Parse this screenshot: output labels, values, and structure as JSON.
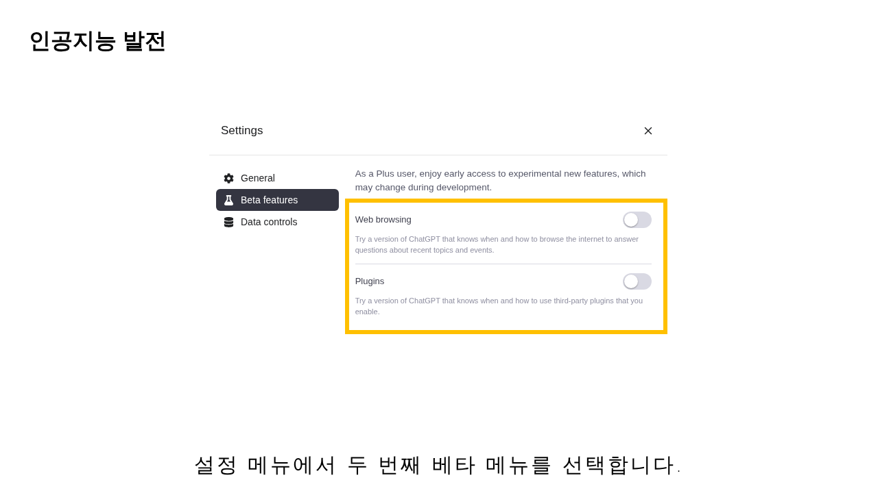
{
  "slide": {
    "title": "인공지능 발전",
    "caption": "설정 메뉴에서 두 번째 베타 메뉴를 선택합니다."
  },
  "dialog": {
    "title": "Settings",
    "sidebar": {
      "items": [
        {
          "label": "General",
          "selected": false
        },
        {
          "label": "Beta features",
          "selected": true
        },
        {
          "label": "Data controls",
          "selected": false
        }
      ]
    },
    "intro": "As a Plus user, enjoy early access to experimental new features, which may change during development.",
    "features": [
      {
        "name": "Web browsing",
        "on": false,
        "description": "Try a version of ChatGPT that knows when and how to browse the internet to answer questions about recent topics and events."
      },
      {
        "name": "Plugins",
        "on": false,
        "description": "Try a version of ChatGPT that knows when and how to use third-party plugins that you enable."
      }
    ]
  }
}
